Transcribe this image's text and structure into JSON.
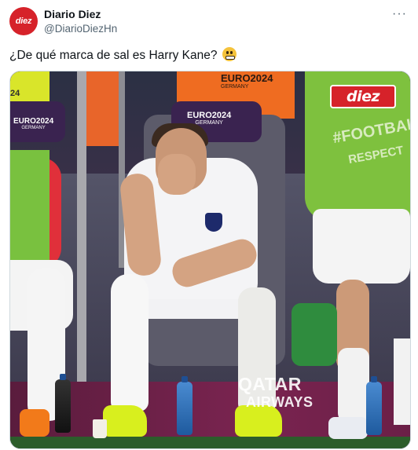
{
  "account": {
    "display_name": "Diario Diez",
    "handle": "@DiarioDiezHn",
    "avatar_text": "diez"
  },
  "post": {
    "text": "¿De qué marca de sal es Harry Kane?",
    "emoji": "grimacing-face-emoji"
  },
  "more_icon": "···",
  "media": {
    "watermark_text": "diez",
    "overlay": {
      "euro_center_main": "EURO2024",
      "euro_center_sub": "GERMANY",
      "euro_left_main": "EURO2024",
      "euro_left_sub": "GERMANY",
      "euro_top_main": "EURO2024",
      "euro_top_sub": "GERMANY",
      "corner_number": "24",
      "ad_line1": "QATAR",
      "ad_line2": "AIRWAYS",
      "bib_line1": "#FOOTBAL",
      "bib_line2": "RESPECT"
    }
  },
  "colors": {
    "brand_red": "#d6222a",
    "text_primary": "#0f1419",
    "text_secondary": "#536471"
  }
}
